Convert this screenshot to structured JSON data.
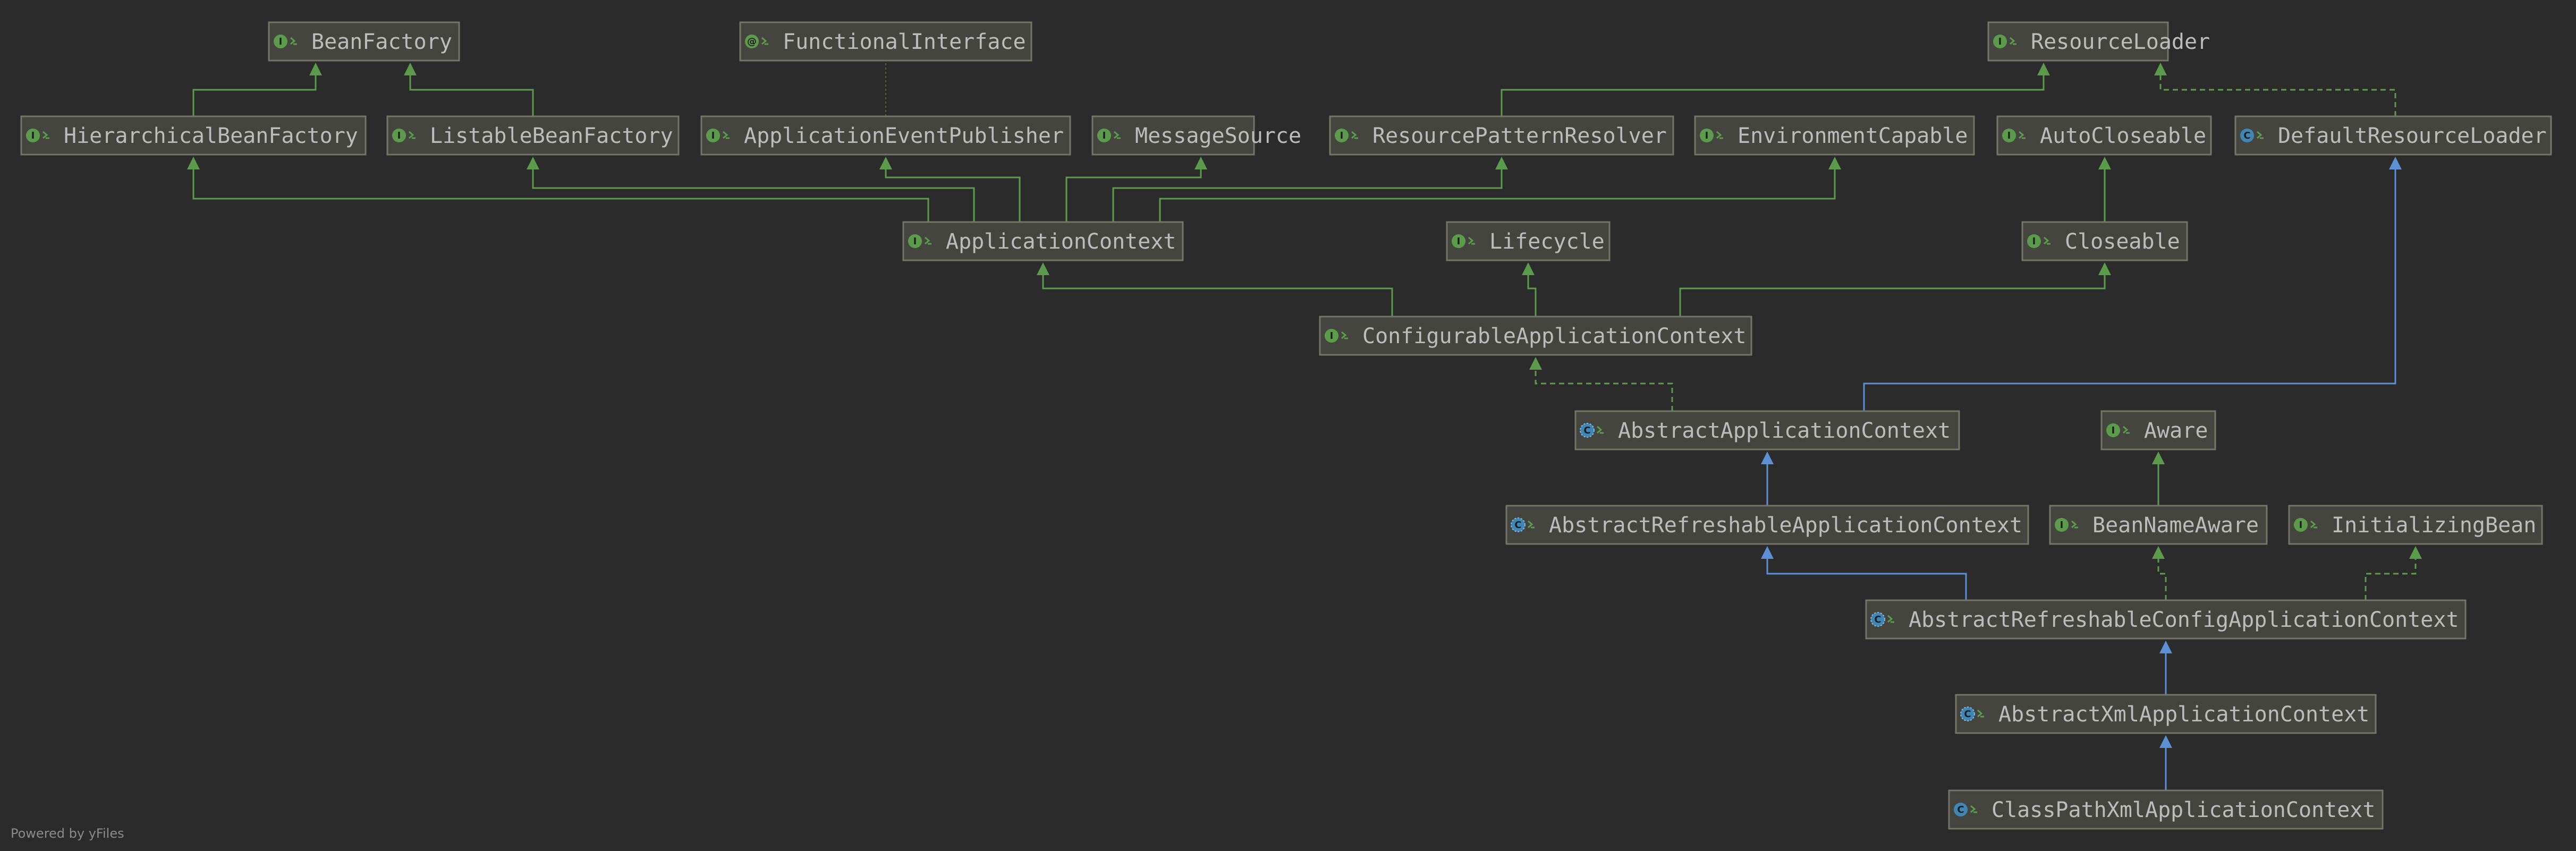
{
  "footer": "Powered by yFiles",
  "colors": {
    "background": "#2b2b2b",
    "node_fill": "#45453f",
    "node_border": "#74746a",
    "text": "#bcbcbc",
    "interface_icon": "#5d9b4c",
    "class_icon": "#3f86b4",
    "implements_edge": "#5d9b4c",
    "extends_edge": "#5b8fd6"
  },
  "nodes": [
    {
      "id": "BeanFactory",
      "label": "BeanFactory",
      "kind": "interface"
    },
    {
      "id": "FunctionalInterface",
      "label": "FunctionalInterface",
      "kind": "annotation"
    },
    {
      "id": "ResourceLoader",
      "label": "ResourceLoader",
      "kind": "interface"
    },
    {
      "id": "HierarchicalBeanFactory",
      "label": "HierarchicalBeanFactory",
      "kind": "interface"
    },
    {
      "id": "ListableBeanFactory",
      "label": "ListableBeanFactory",
      "kind": "interface"
    },
    {
      "id": "ApplicationEventPublisher",
      "label": "ApplicationEventPublisher",
      "kind": "interface"
    },
    {
      "id": "MessageSource",
      "label": "MessageSource",
      "kind": "interface"
    },
    {
      "id": "ResourcePatternResolver",
      "label": "ResourcePatternResolver",
      "kind": "interface"
    },
    {
      "id": "EnvironmentCapable",
      "label": "EnvironmentCapable",
      "kind": "interface"
    },
    {
      "id": "AutoCloseable",
      "label": "AutoCloseable",
      "kind": "interface"
    },
    {
      "id": "DefaultResourceLoader",
      "label": "DefaultResourceLoader",
      "kind": "class"
    },
    {
      "id": "ApplicationContext",
      "label": "ApplicationContext",
      "kind": "interface"
    },
    {
      "id": "Lifecycle",
      "label": "Lifecycle",
      "kind": "interface"
    },
    {
      "id": "Closeable",
      "label": "Closeable",
      "kind": "interface"
    },
    {
      "id": "ConfigurableApplicationContext",
      "label": "ConfigurableApplicationContext",
      "kind": "interface"
    },
    {
      "id": "AbstractApplicationContext",
      "label": "AbstractApplicationContext",
      "kind": "abstract"
    },
    {
      "id": "Aware",
      "label": "Aware",
      "kind": "interface"
    },
    {
      "id": "AbstractRefreshableApplicationContext",
      "label": "AbstractRefreshableApplicationContext",
      "kind": "abstract"
    },
    {
      "id": "BeanNameAware",
      "label": "BeanNameAware",
      "kind": "interface"
    },
    {
      "id": "InitializingBean",
      "label": "InitializingBean",
      "kind": "interface"
    },
    {
      "id": "AbstractRefreshableConfigApplicationContext",
      "label": "AbstractRefreshableConfigApplicationContext",
      "kind": "abstract"
    },
    {
      "id": "AbstractXmlApplicationContext",
      "label": "AbstractXmlApplicationContext",
      "kind": "abstract"
    },
    {
      "id": "ClassPathXmlApplicationContext",
      "label": "ClassPathXmlApplicationContext",
      "kind": "class"
    }
  ],
  "edges": [
    {
      "from": "HierarchicalBeanFactory",
      "to": "BeanFactory",
      "type": "extends-interface"
    },
    {
      "from": "ListableBeanFactory",
      "to": "BeanFactory",
      "type": "extends-interface"
    },
    {
      "from": "ApplicationEventPublisher",
      "to": "FunctionalInterface",
      "type": "annotated"
    },
    {
      "from": "ResourcePatternResolver",
      "to": "ResourceLoader",
      "type": "extends-interface"
    },
    {
      "from": "DefaultResourceLoader",
      "to": "ResourceLoader",
      "type": "implements"
    },
    {
      "from": "ApplicationContext",
      "to": "HierarchicalBeanFactory",
      "type": "extends-interface"
    },
    {
      "from": "ApplicationContext",
      "to": "ListableBeanFactory",
      "type": "extends-interface"
    },
    {
      "from": "ApplicationContext",
      "to": "ApplicationEventPublisher",
      "type": "extends-interface"
    },
    {
      "from": "ApplicationContext",
      "to": "MessageSource",
      "type": "extends-interface"
    },
    {
      "from": "ApplicationContext",
      "to": "ResourcePatternResolver",
      "type": "extends-interface"
    },
    {
      "from": "ApplicationContext",
      "to": "EnvironmentCapable",
      "type": "extends-interface"
    },
    {
      "from": "Closeable",
      "to": "AutoCloseable",
      "type": "extends-interface"
    },
    {
      "from": "ConfigurableApplicationContext",
      "to": "ApplicationContext",
      "type": "extends-interface"
    },
    {
      "from": "ConfigurableApplicationContext",
      "to": "Lifecycle",
      "type": "extends-interface"
    },
    {
      "from": "ConfigurableApplicationContext",
      "to": "Closeable",
      "type": "extends-interface"
    },
    {
      "from": "AbstractApplicationContext",
      "to": "ConfigurableApplicationContext",
      "type": "implements"
    },
    {
      "from": "AbstractApplicationContext",
      "to": "DefaultResourceLoader",
      "type": "extends"
    },
    {
      "from": "BeanNameAware",
      "to": "Aware",
      "type": "extends-interface"
    },
    {
      "from": "AbstractRefreshableApplicationContext",
      "to": "AbstractApplicationContext",
      "type": "extends"
    },
    {
      "from": "AbstractRefreshableConfigApplicationContext",
      "to": "AbstractRefreshableApplicationContext",
      "type": "extends"
    },
    {
      "from": "AbstractRefreshableConfigApplicationContext",
      "to": "BeanNameAware",
      "type": "implements"
    },
    {
      "from": "AbstractRefreshableConfigApplicationContext",
      "to": "InitializingBean",
      "type": "implements"
    },
    {
      "from": "AbstractXmlApplicationContext",
      "to": "AbstractRefreshableConfigApplicationContext",
      "type": "extends"
    },
    {
      "from": "ClassPathXmlApplicationContext",
      "to": "AbstractXmlApplicationContext",
      "type": "extends"
    }
  ]
}
